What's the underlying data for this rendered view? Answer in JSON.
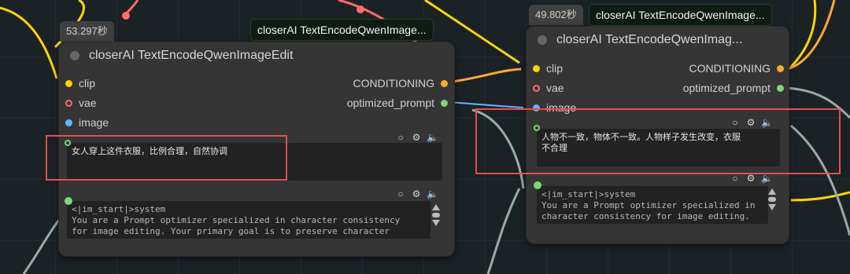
{
  "colors": {
    "canvas_bg": "#1b2226",
    "node_bg": "#353535",
    "wire_yellow": "#ffd500",
    "wire_red": "#ff6b6b",
    "wire_blue": "#64b5f6",
    "wire_grey": "#9aaaa6",
    "highlight": "#e05050"
  },
  "left_node": {
    "timer": "53.297秒",
    "badge": "closerAI TextEncodeQwenImage...",
    "title": "closerAI TextEncodeQwenImageEdit",
    "inputs": [
      "clip",
      "vae",
      "image"
    ],
    "outputs": [
      "CONDITIONING",
      "optimized_prompt"
    ],
    "prompt_text": "女人穿上这件衣服，比例合理，自然协调",
    "system_text": "<|im_start|>system\nYou are a Prompt optimizer specialized in character consistency\nfor image editing. Your primary goal is to preserve character\nidentity while implementing requested changes"
  },
  "right_node": {
    "timer": "49.802秒",
    "badge": "closerAI TextEncodeQwenImage...",
    "title": "closerAI TextEncodeQwenImag...",
    "inputs": [
      "clip",
      "vae",
      "image"
    ],
    "outputs": [
      "CONDITIONING",
      "optimized_prompt"
    ],
    "prompt_text": "人物不一致，物体不一致。人物样子发生改变，衣服\n不合理",
    "system_text": "<|im_start|>system\nYou are a Prompt optimizer specialized in\ncharacter consistency for image editing.\nYour primary goal is to preserve"
  },
  "icons": [
    "circle-icon",
    "gear-icon",
    "speaker-icon",
    "scroll-up-icon",
    "scroll-down-icon"
  ]
}
